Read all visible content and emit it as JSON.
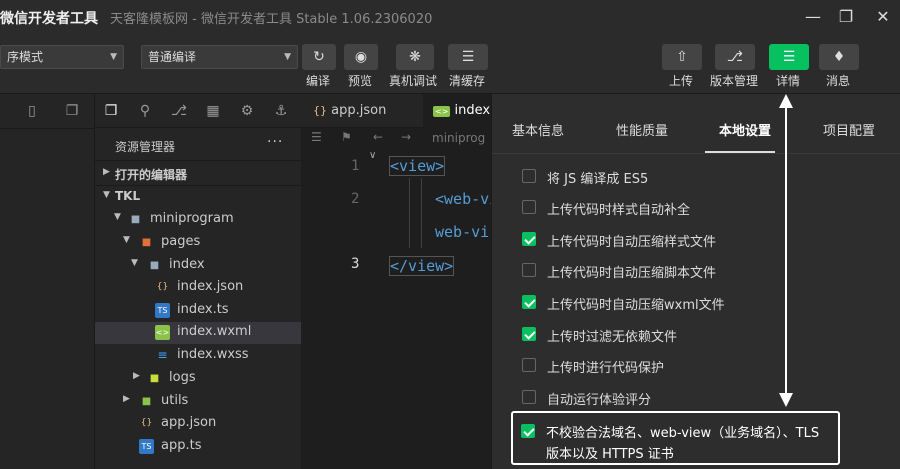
{
  "window": {
    "title": "微信开发者工具",
    "subtitle": "天客隆模板网 - 微信开发者工具 Stable 1.06.2306020"
  },
  "toolbar": {
    "mode_select": "序模式",
    "compile_select": "普通编译",
    "compile_label": "编译",
    "preview_label": "预览",
    "remote_debug_label": "真机调试",
    "clear_cache_label": "清缓存",
    "upload_label": "上传",
    "version_label": "版本管理",
    "details_label": "详情",
    "messages_label": "消息"
  },
  "explorer": {
    "title": "资源管理器",
    "more": "···",
    "open_editors": "打开的编辑器",
    "project": "TKL",
    "tree": [
      "miniprogram",
      "pages",
      "index",
      "index.json",
      "index.ts",
      "index.wxml",
      "index.wxss",
      "logs",
      "utils",
      "app.json",
      "app.ts"
    ]
  },
  "editor": {
    "tabs": [
      "app.json",
      "index"
    ],
    "breadcrumb": "miniprog",
    "line_numbers": [
      "1",
      "2",
      "3"
    ],
    "lines": [
      "<view>",
      "<web-vi",
      "web-vi",
      "</view>"
    ]
  },
  "panel": {
    "tabs": [
      "基本信息",
      "性能质量",
      "本地设置",
      "项目配置"
    ],
    "options": [
      {
        "label": "将 JS 编译成 ES5",
        "checked": false
      },
      {
        "label": "上传代码时样式自动补全",
        "checked": false
      },
      {
        "label": "上传代码时自动压缩样式文件",
        "checked": true
      },
      {
        "label": "上传代码时自动压缩脚本文件",
        "checked": false
      },
      {
        "label": "上传代码时自动压缩wxml文件",
        "checked": true
      },
      {
        "label": "上传时过滤无依赖文件",
        "checked": true
      },
      {
        "label": "上传时进行代码保护",
        "checked": false
      },
      {
        "label": "自动运行体验评分",
        "checked": false
      }
    ],
    "highlight_option": {
      "line1": "不校验合法域名、web-view（业务域名）、TLS",
      "line2": "版本以及 HTTPS 证书",
      "checked": true
    }
  },
  "colors": {
    "accent": "#07c160",
    "background": "#1e1e1e",
    "panel": "#2d2d2d"
  }
}
